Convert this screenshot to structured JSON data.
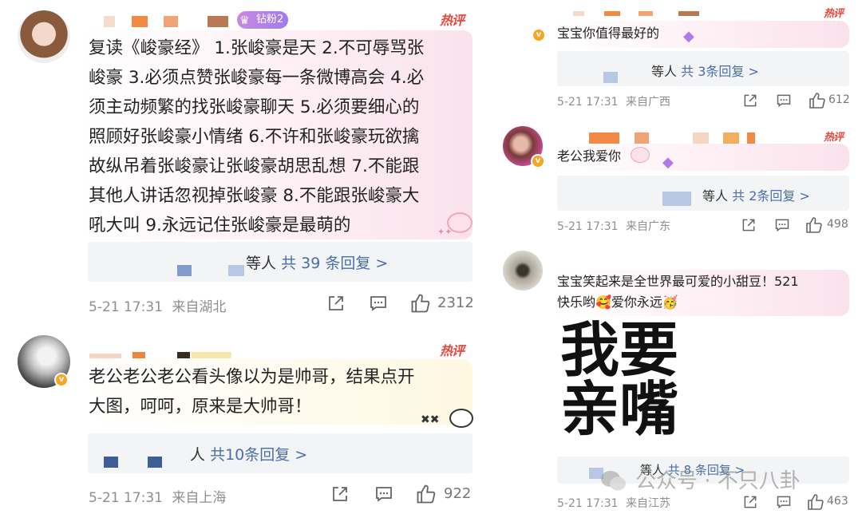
{
  "left": {
    "c1": {
      "badge": "钻粉2",
      "hot": "热评",
      "text": "复读《峻豪经》 1.张峻豪是天 2.不可辱骂张峻豪 3.必须点赞张峻豪每一条微博高会 4.必须主动频繁的找张峻豪聊天 5.必须要细心的照顾好张峻豪小情绪 6.不许和张峻豪玩欲擒故纵吊着张峻豪让张峻豪胡思乱想 7.不能跟其他人讲话忽视掉张峻豪 8.不能跟张峻豪大吼大叫 9.永远记住张峻豪是最萌的",
      "lines": [
        "复读《峻豪经》 1.张峻豪是天 2.不可辱骂张",
        "峻豪 3.必须点赞张峻豪每一条微博高会 4.必",
        "须主动频繁的找张峻豪聊天 5.必须要细心的",
        "照顾好张峻豪小情绪 6.不许和张峻豪玩欲擒",
        "故纵吊着张峻豪让张峻豪胡思乱想 7.不能跟",
        "其他人讲话忽视掉张峻豪 8.不能跟张峻豪大",
        "吼大叫 9.永远记住张峻豪是最萌的"
      ],
      "reply_prefix": "等人",
      "reply_link": "共 39 条回复 >",
      "time": "5-21 17:31",
      "location": "来自湖北",
      "likes": "2312"
    },
    "c2": {
      "hot": "热评",
      "lines": [
        "老公老公老公看头像以为是帅哥，结果点开",
        "大图，呵呵，原来是大帅哥！"
      ],
      "reply_prefix": "人",
      "reply_link": "共10条回复 >",
      "time": "5-21 17:31",
      "location": "来自上海",
      "likes": "922"
    }
  },
  "right": {
    "c1": {
      "hot": "热评",
      "text": "宝宝你值得最好的",
      "reply_prefix": "等人",
      "reply_link": "共 3条回复 >",
      "time": "5-21 17:31",
      "location": "来自广西",
      "likes": "612"
    },
    "c2": {
      "hot": "热评",
      "text": "老公我爱你",
      "reply_prefix": "等人",
      "reply_link": "共 2条回复 >",
      "time": "5-21 17:31",
      "location": "来自广东",
      "likes": "498"
    },
    "c3": {
      "lines": [
        "宝宝笑起来是全世界最可爱的小甜豆！521",
        "快乐哟🥰爱你永远🥳"
      ],
      "big_line1": "我要",
      "big_line2": "亲嘴",
      "reply_prefix": "等人",
      "reply_link": "共 8 条回复 >",
      "time": "5-21 17:31",
      "location": "来自江苏",
      "likes": "463"
    },
    "watermark": "公众号 · 不只八卦"
  },
  "colors": {
    "hot": "#e8473c",
    "link": "#4a6ea8",
    "meta": "#8f8f8f",
    "reply_bg": "#f3f4f6",
    "badge": "#f5a623"
  }
}
